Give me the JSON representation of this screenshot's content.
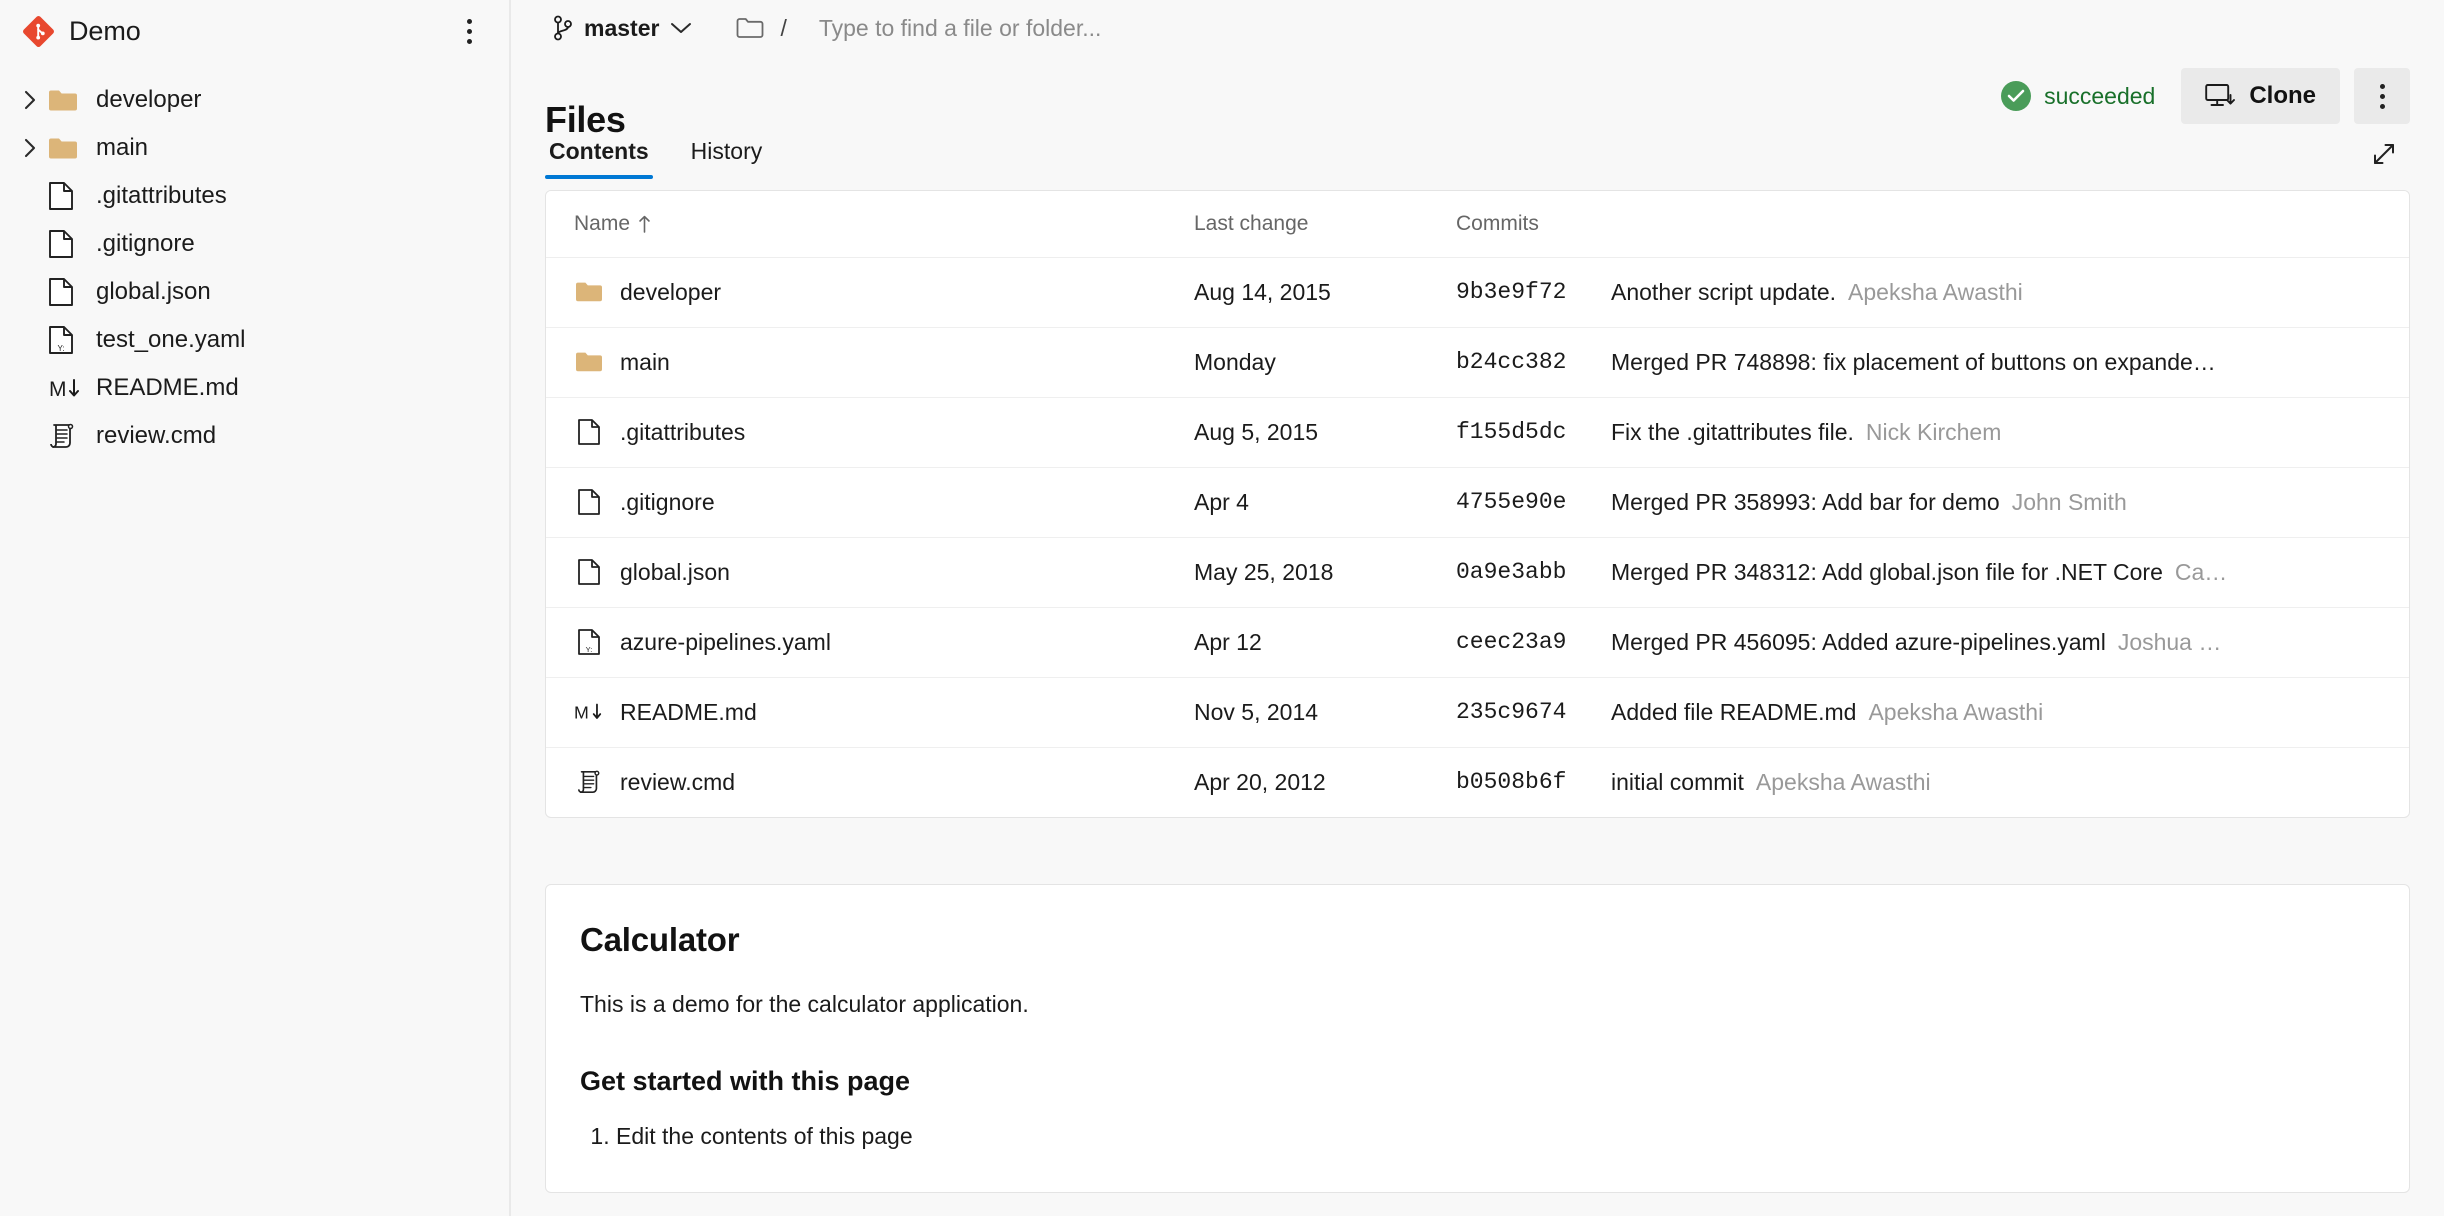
{
  "sidebar": {
    "repo_name": "Demo",
    "logo_icon": "git-logo-icon",
    "more_menu_icon": "kebab-menu-icon",
    "tree": [
      {
        "label": "developer",
        "icon": "folder-icon",
        "expandable": true,
        "chevron": "chevron-right-icon"
      },
      {
        "label": "main",
        "icon": "folder-icon",
        "expandable": true,
        "chevron": "chevron-right-icon"
      },
      {
        "label": ".gitattributes",
        "icon": "file-icon",
        "expandable": false
      },
      {
        "label": ".gitignore",
        "icon": "file-icon",
        "expandable": false
      },
      {
        "label": "global.json",
        "icon": "file-icon",
        "expandable": false
      },
      {
        "label": "test_one.yaml",
        "icon": "yaml-file-icon",
        "expandable": false
      },
      {
        "label": "README.md",
        "icon": "markdown-icon",
        "expandable": false
      },
      {
        "label": "review.cmd",
        "icon": "script-icon",
        "expandable": false
      }
    ]
  },
  "topbar": {
    "branch_icon": "git-branch-icon",
    "branch_name": "master",
    "branch_chevron_icon": "chevron-down-icon",
    "folder_icon": "folder-outline-icon",
    "path_separator": "/",
    "find_placeholder": "Type to find a file or folder...",
    "find_value": ""
  },
  "header": {
    "title": "Files",
    "status_icon": "check-circle-icon",
    "status_label": "succeeded",
    "status_color": "#19702a",
    "clone_icon": "clone-download-icon",
    "clone_label": "Clone",
    "more_icon": "kebab-menu-icon"
  },
  "tabs": {
    "items": [
      {
        "label": "Contents",
        "active": true
      },
      {
        "label": "History",
        "active": false
      }
    ],
    "active_underline_color": "#0078d4",
    "expand_icon": "expand-diagonal-icon"
  },
  "table": {
    "columns": [
      {
        "key": "name",
        "label": "Name",
        "sort_icon": "sort-ascending-arrow-icon"
      },
      {
        "key": "date",
        "label": "Last change"
      },
      {
        "key": "commit",
        "label": "Commits"
      },
      {
        "key": "msg",
        "label": ""
      }
    ],
    "rows": [
      {
        "icon": "folder-icon",
        "name": "developer",
        "date": "Aug 14, 2015",
        "commit": "9b3e9f72",
        "message": "Another script update.",
        "author": "Apeksha Awasthi"
      },
      {
        "icon": "folder-icon",
        "name": "main",
        "date": "Monday",
        "commit": "b24cc382",
        "message": "Merged PR 748898: fix placement of buttons on expande…",
        "author": ""
      },
      {
        "icon": "file-icon",
        "name": ".gitattributes",
        "date": "Aug 5, 2015",
        "commit": "f155d5dc",
        "message": "Fix the .gitattributes file.",
        "author": "Nick Kirchem"
      },
      {
        "icon": "file-icon",
        "name": ".gitignore",
        "date": "Apr 4",
        "commit": "4755e90e",
        "message": "Merged PR 358993: Add bar for demo",
        "author": "John Smith"
      },
      {
        "icon": "file-icon",
        "name": "global.json",
        "date": "May 25, 2018",
        "commit": "0a9e3abb",
        "message": "Merged PR 348312: Add global.json file for .NET Core",
        "author": "Ca…"
      },
      {
        "icon": "yaml-file-icon",
        "name": "azure-pipelines.yaml",
        "date": "Apr 12",
        "commit": "ceec23a9",
        "message": "Merged PR 456095: Added azure-pipelines.yaml",
        "author": "Joshua …"
      },
      {
        "icon": "markdown-icon",
        "name": "README.md",
        "date": "Nov 5, 2014",
        "commit": "235c9674",
        "message": "Added file README.md",
        "author": "Apeksha Awasthi"
      },
      {
        "icon": "script-icon",
        "name": "review.cmd",
        "date": "Apr 20, 2012",
        "commit": "b0508b6f",
        "message": "initial commit",
        "author": "Apeksha Awasthi"
      }
    ]
  },
  "readme": {
    "heading": "Calculator",
    "paragraph": "This is a demo for the calculator application.",
    "subheading": "Get started with this page",
    "list": [
      "Edit the contents of this page"
    ]
  }
}
